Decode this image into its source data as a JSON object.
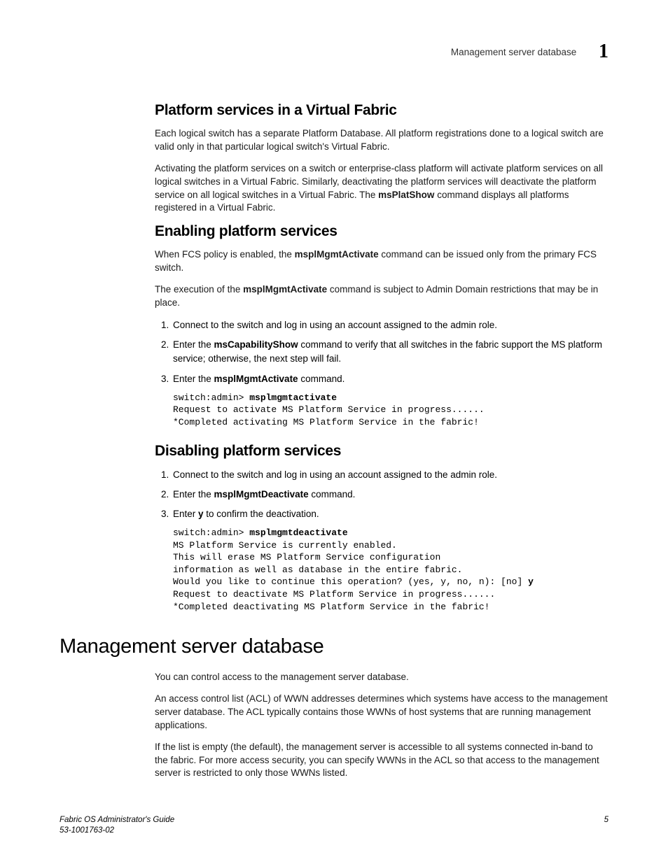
{
  "header": {
    "title": "Management server database",
    "chapter_number": "1"
  },
  "sections": {
    "s1": {
      "heading": "Platform services in a Virtual Fabric",
      "p1": "Each logical switch has a separate Platform Database. All platform registrations done to a logical switch are valid only in that particular logical switch's Virtual Fabric.",
      "p2a": "Activating the platform services on a switch or enterprise-class platform will activate platform services on all logical switches in a Virtual Fabric. Similarly, deactivating the platform services will deactivate the platform service on all logical switches in a Virtual Fabric. The ",
      "p2b": "msPlatShow",
      "p2c": " command displays all platforms registered in a Virtual Fabric."
    },
    "s2": {
      "heading": "Enabling platform services",
      "p1a": "When FCS policy is enabled, the ",
      "p1b": "msplMgmtActivate",
      "p1c": " command can be issued only from the primary FCS switch.",
      "p2a": "The execution of the ",
      "p2b": "msplMgmtActivate",
      "p2c": " command is subject to Admin Domain restrictions that may be in place.",
      "li1": "Connect to the switch and log in using an account assigned to the admin role.",
      "li2a": "Enter the ",
      "li2b": "msCapabilityShow",
      "li2c": " command to verify that all switches in the fabric support the MS platform service; otherwise, the next step will fail.",
      "li3a": "Enter the ",
      "li3b": "msplMgmtActivate",
      "li3c": " command.",
      "code_prompt": "switch:admin> ",
      "code_cmd": "msplmgmtactivate",
      "code_out": "Request to activate MS Platform Service in progress......\n*Completed activating MS Platform Service in the fabric!"
    },
    "s3": {
      "heading": "Disabling platform services",
      "li1": "Connect to the switch and log in using an account assigned to the admin role.",
      "li2a": "Enter the ",
      "li2b": "msplMgmtDeactivate",
      "li2c": " command.",
      "li3a": "Enter ",
      "li3b": "y",
      "li3c": " to confirm the deactivation.",
      "code_prompt": "switch:admin> ",
      "code_cmd": "msplmgmtdeactivate",
      "code_mid": "MS Platform Service is currently enabled.\nThis will erase MS Platform Service configuration\ninformation as well as database in the entire fabric.\nWould you like to continue this operation? (yes, y, no, n): [no] ",
      "code_input": "y",
      "code_out": "Request to deactivate MS Platform Service in progress......\n*Completed deactivating MS Platform Service in the fabric!"
    },
    "s4": {
      "heading": "Management server database",
      "p1": "You can control access to the management server database.",
      "p2": "An access control list (ACL) of WWN addresses determines which systems have access to the management server database. The ACL typically contains those WWNs of host systems that are running management applications.",
      "p3": "If the list is empty (the default), the management server is accessible to all systems connected in-band to the fabric. For more access security, you can specify WWNs in the ACL so that access to the management server is restricted to only those WWNs listed."
    }
  },
  "footer": {
    "doc_title": "Fabric OS Administrator's Guide",
    "doc_id": "53-1001763-02",
    "page_number": "5"
  }
}
